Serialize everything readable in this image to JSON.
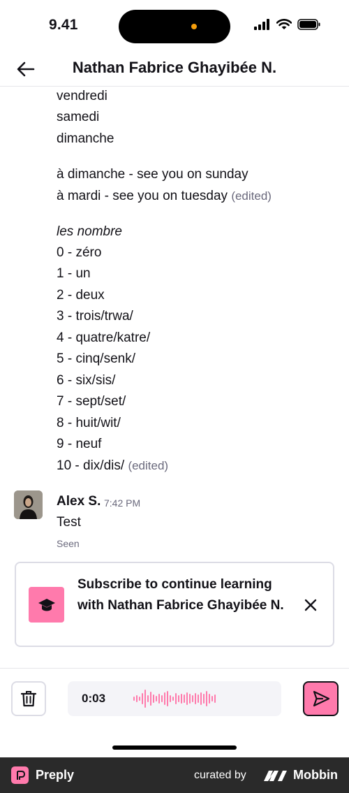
{
  "status_bar": {
    "time": "9.41"
  },
  "header": {
    "title": "Nathan Fabrice Ghayibée N."
  },
  "messages": {
    "lines": [
      {
        "text": "vendredi",
        "edited": ""
      },
      {
        "text": "samedi",
        "edited": ""
      },
      {
        "text": "dimanche",
        "edited": ""
      },
      {
        "text": "à dimanche - see you on sunday",
        "edited": ""
      },
      {
        "text": "à mardi - see you on tuesday",
        "edited": "(edited)"
      },
      {
        "text": "les nombre",
        "edited": ""
      },
      {
        "text": "0 - zéro",
        "edited": ""
      },
      {
        "text": "1 - un",
        "edited": ""
      },
      {
        "text": "2 - deux",
        "edited": ""
      },
      {
        "text": "3 - trois/trwa/",
        "edited": ""
      },
      {
        "text": "4 - quatre/katre/",
        "edited": ""
      },
      {
        "text": "5 - cinq/senk/",
        "edited": ""
      },
      {
        "text": "6 - six/sis/",
        "edited": ""
      },
      {
        "text": "7 - sept/set/",
        "edited": ""
      },
      {
        "text": "8 - huit/wit/",
        "edited": ""
      },
      {
        "text": "9 - neuf",
        "edited": ""
      },
      {
        "text": "10 - dix/dis/",
        "edited": "(edited)"
      }
    ],
    "reply": {
      "sender": "Alex S.",
      "time": "7:42 PM",
      "text": "Test",
      "status": "Seen"
    }
  },
  "subscribe_card": {
    "text": "Subscribe to continue learning with Nathan Fabrice Ghayibée N.",
    "icon": "graduation-cap-icon"
  },
  "composer": {
    "recording_time": "0:03",
    "delete_icon": "trash-icon",
    "send_icon": "send-icon"
  },
  "footer": {
    "brand": "Preply",
    "curated_label": "curated by",
    "curator": "Mobbin"
  },
  "colors": {
    "accent": "#ff7aac",
    "text": "#121117",
    "muted": "#6a697c",
    "border": "#dcdce5"
  }
}
